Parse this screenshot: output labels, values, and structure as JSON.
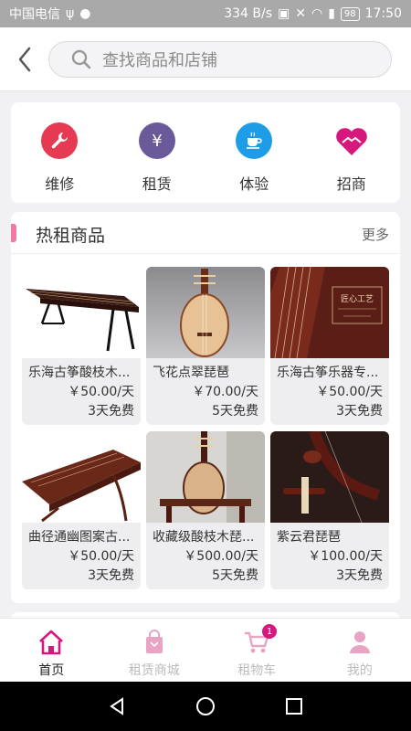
{
  "status_bar": {
    "carrier": "中国电信",
    "speed": "334 B/s",
    "battery": "98",
    "time": "17:50"
  },
  "search": {
    "placeholder": "查找商品和店铺"
  },
  "categories": [
    {
      "label": "维修",
      "icon": "wrench-icon",
      "color": "#e63a52"
    },
    {
      "label": "租赁",
      "icon": "rent-icon",
      "color": "#6b5a9a"
    },
    {
      "label": "体验",
      "icon": "coffee-cup-icon",
      "color": "#1e9de6"
    },
    {
      "label": "招商",
      "icon": "handshake-heart-icon",
      "color": "#d6177d"
    }
  ],
  "hot_section": {
    "title": "热租商品",
    "more": "更多",
    "products": [
      {
        "name": "乐海古筝酸枝木...",
        "price": "￥50.00/天",
        "free": "3天免费"
      },
      {
        "name": "飞花点翠琵琶",
        "price": "￥70.00/天",
        "free": "5天免费"
      },
      {
        "name": "乐海古筝乐器专...",
        "price": "￥50.00/天",
        "free": "3天免费",
        "image_text": "匠心工艺"
      },
      {
        "name": "曲径通幽图案古...",
        "price": "￥50.00/天",
        "free": "3天免费"
      },
      {
        "name": "收藏级酸枝木琵...",
        "price": "￥500.00/天",
        "free": "5天免费"
      },
      {
        "name": "紫云君琵琶",
        "price": "￥100.00/天",
        "free": "3天免费"
      }
    ]
  },
  "tabbar": {
    "tabs": [
      {
        "label": "首页",
        "icon": "home-icon",
        "active": true
      },
      {
        "label": "租赁商城",
        "icon": "shopping-bag-icon"
      },
      {
        "label": "租物车",
        "icon": "cart-icon",
        "badge": "1"
      },
      {
        "label": "我的",
        "icon": "user-icon"
      }
    ]
  },
  "colors": {
    "accent": "#d6177d",
    "hot_bar": "#ee7aa5"
  }
}
